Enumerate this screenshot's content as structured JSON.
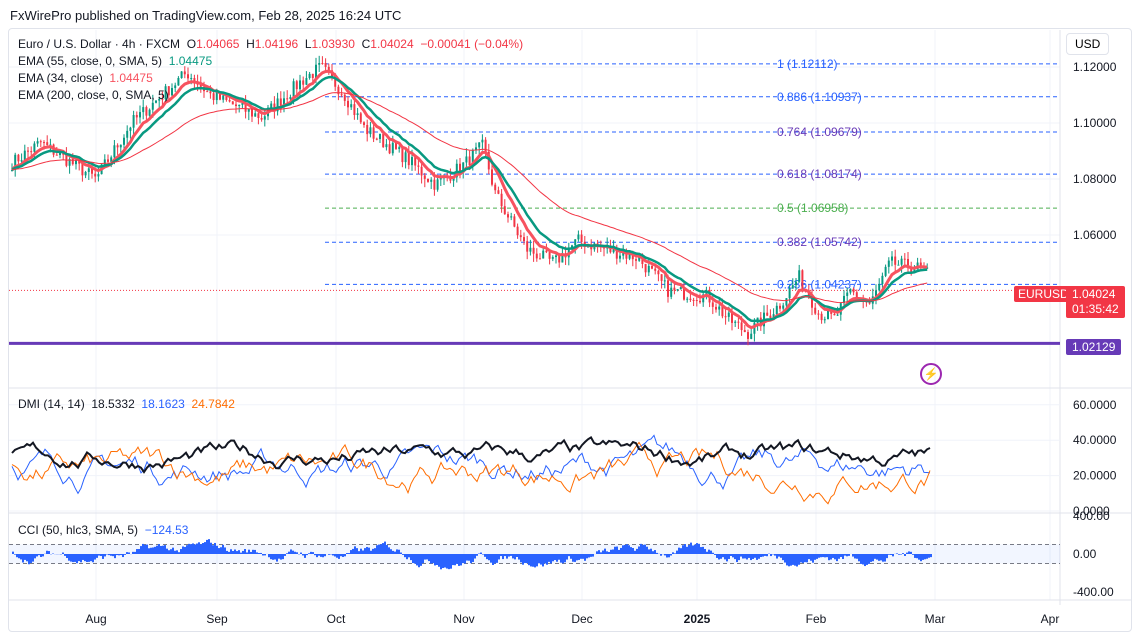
{
  "header": {
    "published": "FxWirePro published on TradingView.com, Feb 28, 2025 16:24 UTC"
  },
  "legend": {
    "symbol": "Euro / U.S. Dollar · 4h · FXCM",
    "o_label": "O",
    "o": "1.04065",
    "h_label": "H",
    "h": "1.04196",
    "l_label": "L",
    "l": "1.03930",
    "c_label": "C",
    "c": "1.04024",
    "chg": "−0.00041 (−0.04%)",
    "ema55": "EMA (55, close, 0, SMA, 5)",
    "ema55_val": "1.04475",
    "ema34": "EMA (34, close)",
    "ema34_val": "1.04475",
    "ema200": "EMA (200, close, 0, SMA, 5)"
  },
  "currency_button": "USD",
  "price_tag": {
    "symbol": "EURUSD",
    "price": "1.04024",
    "countdown": "01:35:42"
  },
  "support_tag": "1.02129",
  "dmi": {
    "label": "DMI (14, 14)",
    "adx": "18.5332",
    "plus": "18.1623",
    "minus": "24.7842"
  },
  "cci": {
    "label": "CCI (50, hlc3, SMA, 5)",
    "val": "−124.53"
  },
  "colors": {
    "up": "#089981",
    "down": "#f23645",
    "ema34": "#f7525f",
    "ema55": "#089981",
    "ema200": "#f23645",
    "support": "#673ab7",
    "adx": "#131722",
    "plus": "#2962ff",
    "minus": "#ff6d00",
    "cci": "#2962ff"
  },
  "chart_data": [
    {
      "type": "candlestick",
      "title": "Euro / U.S. Dollar · 4h · FXCM",
      "ylim": [
        1.015,
        1.125
      ],
      "yticks": [
        "1.12000",
        "1.10000",
        "1.08000",
        "1.06000"
      ],
      "xticks": [
        "Aug",
        "Sep",
        "Oct",
        "Nov",
        "Dec",
        "2025",
        "Feb",
        "Mar",
        "Apr"
      ],
      "price_path_day_from_jul1": [
        [
          9,
          1.085
        ],
        [
          17,
          1.093
        ],
        [
          31,
          1.08
        ],
        [
          40,
          1.1
        ],
        [
          54,
          1.118
        ],
        [
          60,
          1.11
        ],
        [
          73,
          1.102
        ],
        [
          83,
          1.115
        ],
        [
          88,
          1.12
        ],
        [
          94,
          1.11
        ],
        [
          99,
          1.098
        ],
        [
          109,
          1.088
        ],
        [
          117,
          1.078
        ],
        [
          124,
          1.085
        ],
        [
          129,
          1.092
        ],
        [
          132,
          1.075
        ],
        [
          140,
          1.055
        ],
        [
          147,
          1.05
        ],
        [
          153,
          1.058
        ],
        [
          160,
          1.055
        ],
        [
          168,
          1.052
        ],
        [
          176,
          1.04
        ],
        [
          186,
          1.038
        ],
        [
          191,
          1.03
        ],
        [
          196,
          1.025
        ],
        [
          204,
          1.035
        ],
        [
          209,
          1.045
        ],
        [
          214,
          1.032
        ],
        [
          218,
          1.03
        ],
        [
          222,
          1.04
        ],
        [
          227,
          1.035
        ],
        [
          232,
          1.05
        ],
        [
          240,
          1.048
        ],
        [
          243,
          1.044
        ],
        [
          244,
          1.04
        ]
      ],
      "fibonacci": [
        {
          "label": "1 (1.12112)",
          "price": 1.12112
        },
        {
          "label": "0.886 (1.10937)",
          "price": 1.10937
        },
        {
          "label": "0.764 (1.09679)",
          "price": 1.09679
        },
        {
          "label": "0.618 (1.08174)",
          "price": 1.08174
        },
        {
          "label": "0.5 (1.06958)",
          "price": 1.06958
        },
        {
          "label": "0.382 (1.05742)",
          "price": 1.05742
        },
        {
          "label": "0.236 (1.04237)",
          "price": 1.04237
        }
      ],
      "support_line": 1.02129,
      "last_price": 1.04024
    },
    {
      "type": "line",
      "title": "DMI (14, 14)",
      "ylim": [
        0,
        65
      ],
      "yticks": [
        "60.0000",
        "40.0000",
        "20.0000",
        "0.0000"
      ]
    },
    {
      "type": "histogram",
      "title": "CCI (50, hlc3, SMA, 5)",
      "ylim": [
        -450,
        450
      ],
      "yticks": [
        "400.00",
        "0.00",
        "-400.00"
      ],
      "bands": [
        100,
        -100
      ]
    }
  ]
}
